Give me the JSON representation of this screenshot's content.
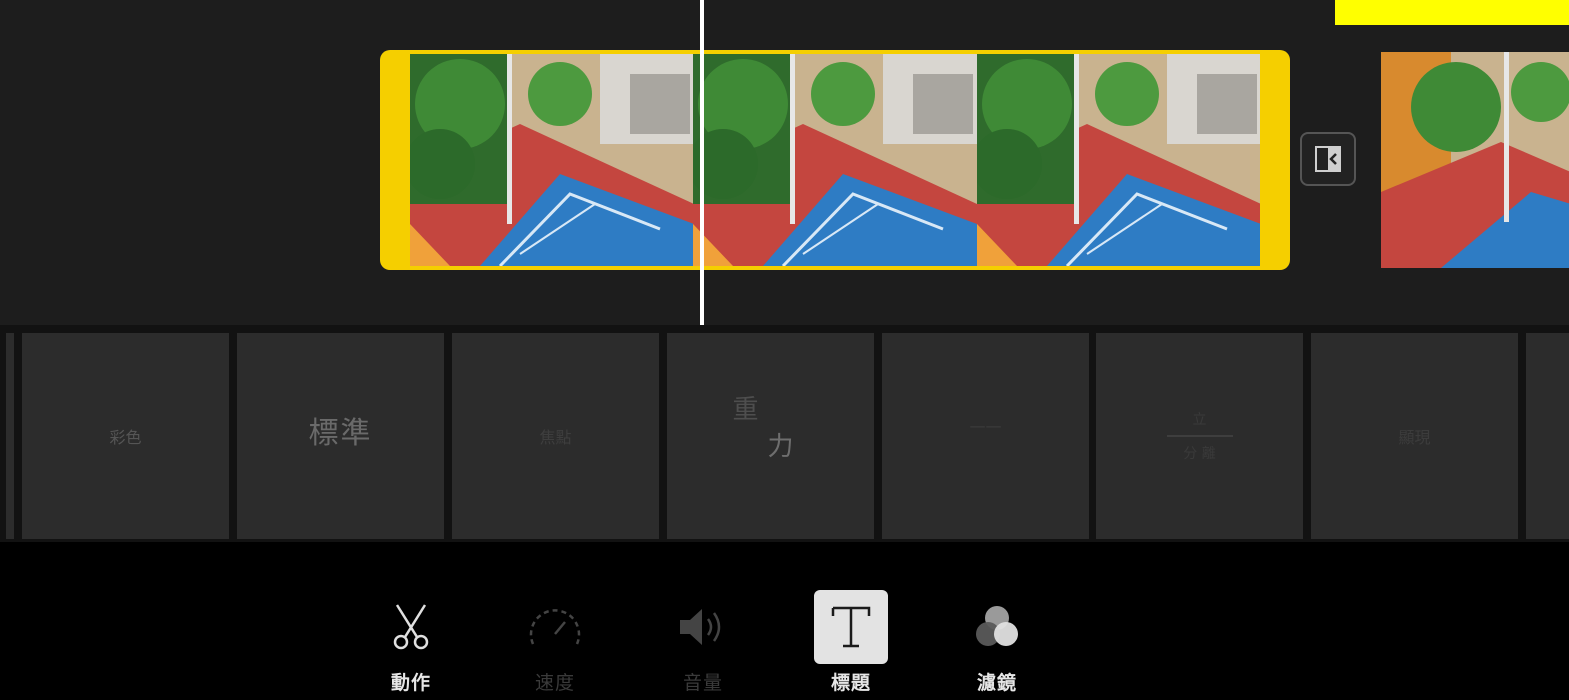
{
  "colors": {
    "clip_border": "#f5cf00",
    "playhead": "#ffffff",
    "highlight_tag": "#ffff00",
    "selected_tool_bg": "#e3e3e3"
  },
  "timeline": {
    "clip": {
      "frames": 3
    },
    "transition_icon": "transition-icon"
  },
  "presets": {
    "items": [
      {
        "label": "彩色"
      },
      {
        "label": "標準"
      },
      {
        "label": "焦點"
      },
      {
        "label_line1": "重",
        "label_line2": "力"
      },
      {
        "label": "一一"
      },
      {
        "label_line1": "立",
        "label_line2": "分 離"
      },
      {
        "label": "顯現"
      },
      {
        "label": ""
      }
    ]
  },
  "toolbar": {
    "tools": [
      {
        "label": "動作",
        "icon": "scissors-icon",
        "state": "enabled"
      },
      {
        "label": "速度",
        "icon": "speedometer-icon",
        "state": "disabled"
      },
      {
        "label": "音量",
        "icon": "speaker-icon",
        "state": "disabled"
      },
      {
        "label": "標題",
        "icon": "title-T-icon",
        "state": "selected"
      },
      {
        "label": "濾鏡",
        "icon": "filters-icon",
        "state": "enabled"
      }
    ]
  }
}
